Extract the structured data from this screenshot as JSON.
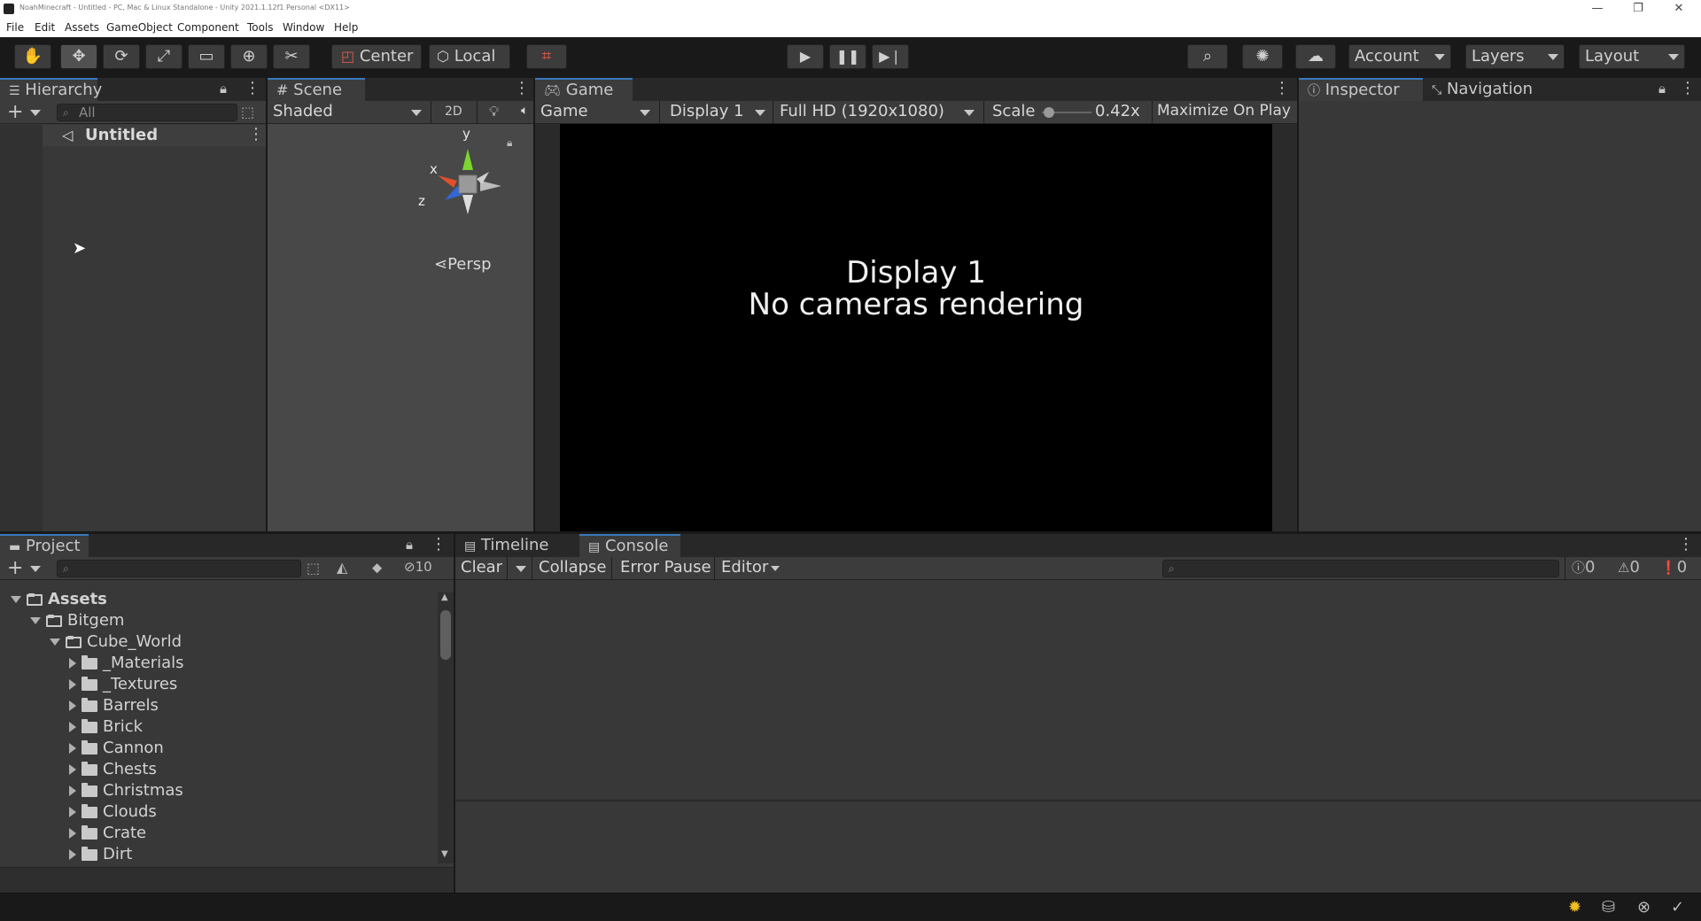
{
  "window": {
    "title": "NoahMinecraft - Untitled - PC, Mac & Linux Standalone - Unity 2021.1.12f1 Personal <DX11>",
    "minimize": "—",
    "maximize": "❐",
    "close": "✕"
  },
  "menu": [
    "File",
    "Edit",
    "Assets",
    "GameObject",
    "Component",
    "Tools",
    "Window",
    "Help"
  ],
  "toolbar": {
    "pivot": "Center",
    "space": "Local",
    "account": "Account",
    "layers": "Layers",
    "layout": "Layout"
  },
  "hierarchy": {
    "tab": "Hierarchy",
    "search_placeholder": "All",
    "scene": "Untitled"
  },
  "scene": {
    "tab": "Scene",
    "shading": "Shaded",
    "mode2d": "2D",
    "projection": "Persp",
    "axes": {
      "y": "y",
      "x": "x",
      "z": "z"
    }
  },
  "game": {
    "tab": "Game",
    "view": "Game",
    "display": "Display 1",
    "resolution": "Full HD (1920x1080)",
    "scale_label": "Scale",
    "scale_value": "0.42x",
    "scale_level": 0.05,
    "maximize": "Maximize On Play",
    "message_line1": "Display 1",
    "message_line2": "No cameras rendering"
  },
  "inspector": {
    "tab": "Inspector",
    "nav_tab": "Navigation"
  },
  "project": {
    "tab": "Project",
    "hidden_count": "10",
    "tree": [
      {
        "label": "Assets",
        "depth": 0,
        "expanded": true,
        "bold": true
      },
      {
        "label": "Bitgem",
        "depth": 1,
        "expanded": true
      },
      {
        "label": "Cube_World",
        "depth": 2,
        "expanded": true
      },
      {
        "label": "_Materials",
        "depth": 3,
        "expanded": false
      },
      {
        "label": "_Textures",
        "depth": 3,
        "expanded": false
      },
      {
        "label": "Barrels",
        "depth": 3,
        "expanded": false
      },
      {
        "label": "Brick",
        "depth": 3,
        "expanded": false
      },
      {
        "label": "Cannon",
        "depth": 3,
        "expanded": false
      },
      {
        "label": "Chests",
        "depth": 3,
        "expanded": false
      },
      {
        "label": "Christmas",
        "depth": 3,
        "expanded": false
      },
      {
        "label": "Clouds",
        "depth": 3,
        "expanded": false
      },
      {
        "label": "Crate",
        "depth": 3,
        "expanded": false
      },
      {
        "label": "Dirt",
        "depth": 3,
        "expanded": false
      }
    ]
  },
  "console": {
    "timeline_tab": "Timeline",
    "tab": "Console",
    "clear": "Clear",
    "collapse": "Collapse",
    "error_pause": "Error Pause",
    "editor": "Editor",
    "log_count": "0",
    "warn_count": "0",
    "error_count": "0"
  },
  "colors": {
    "accent": "#3a79bb",
    "panel": "#383838",
    "tabstrip": "#282828",
    "game_bg": "#000000"
  }
}
